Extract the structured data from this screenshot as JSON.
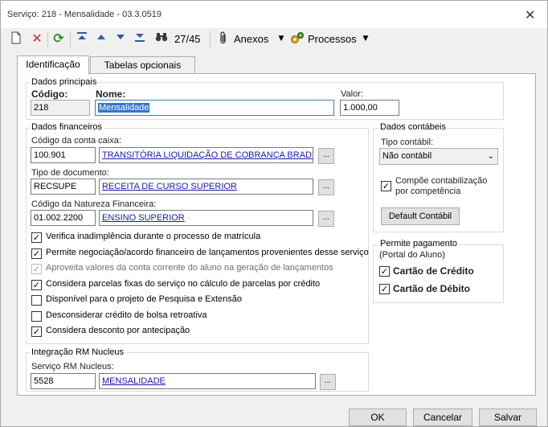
{
  "window": {
    "title": "Serviço: 218 - Mensalidade - 03.3.0519"
  },
  "toolbar": {
    "record_position": "27/45",
    "anexos_label": "Anexos",
    "processos_label": "Processos"
  },
  "tabs": [
    {
      "label": "Identificação"
    },
    {
      "label": "Tabelas opcionais"
    }
  ],
  "dados_principais": {
    "title": "Dados principais",
    "codigo_label": "Código:",
    "codigo_value": "218",
    "nome_label": "Nome:",
    "nome_value": "Mensalidade",
    "valor_label": "Valor:",
    "valor_value": "1.000,00"
  },
  "dados_financeiros": {
    "title": "Dados financeiros",
    "conta_caixa_label": "Código da conta caixa:",
    "conta_caixa_code": "100.901",
    "conta_caixa_desc": "TRANSITÓRIA LIQUIDAÇÃO DE COBRANÇA BRADE",
    "tipo_doc_label": "Tipo de documento:",
    "tipo_doc_code": "RECSUPE",
    "tipo_doc_desc": "RECEITA DE CURSO SUPERIOR",
    "natureza_label": "Código da Natureza Financeira:",
    "natureza_code": "01.002.2200",
    "natureza_desc": "ENSINO SUPERIOR",
    "ellipsis": "...",
    "options": [
      {
        "label": "Verifica inadimplência durante o processo de matrícula",
        "checked": true,
        "disabled": false
      },
      {
        "label": "Permite negociação/acordo financeiro de lançamentos provenientes desse serviço",
        "checked": true,
        "disabled": false
      },
      {
        "label": "Aproveita valores da conta corrente do aluno na geração de lançamentos",
        "checked": true,
        "disabled": true
      },
      {
        "label": "Considera parcelas fixas do serviço no cálculo de parcelas por crédito",
        "checked": true,
        "disabled": false
      },
      {
        "label": "Disponível para o projeto de Pesquisa e Extensão",
        "checked": false,
        "disabled": false
      },
      {
        "label": "Desconsiderar crédito de bolsa retroativa",
        "checked": false,
        "disabled": false
      },
      {
        "label": "Considera desconto por antecipação",
        "checked": true,
        "disabled": false
      }
    ]
  },
  "integracao": {
    "title": "Integração RM Nucleus",
    "servico_label": "Serviço RM Nucleus:",
    "servico_code": "5528",
    "servico_desc": "MENSALIDADE"
  },
  "dados_contabeis": {
    "title": "Dados contábeis",
    "tipo_label": "Tipo contábil:",
    "tipo_value": "Não contábil",
    "compoe_line1": "Compõe contabilização",
    "compoe_line2": "por competência",
    "compoe_checked": true,
    "default_button": "Default Contábil"
  },
  "permite_pagamento": {
    "title": "Permite pagamento",
    "subtitle": "(Portal do Aluno)",
    "credito_label": "Cartão de Crédito",
    "debito_label": "Cartão de Débito"
  },
  "footer": {
    "ok": "OK",
    "cancelar": "Cancelar",
    "salvar": "Salvar"
  },
  "check_glyph": "✓"
}
